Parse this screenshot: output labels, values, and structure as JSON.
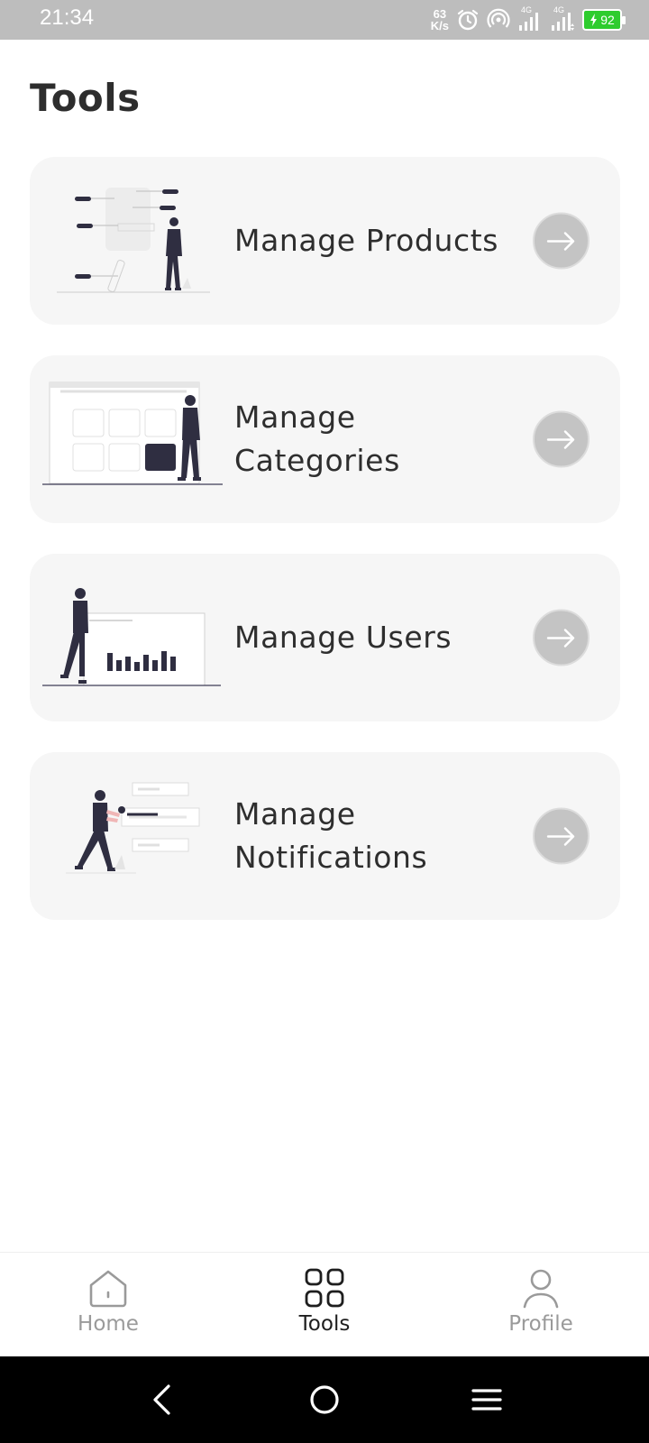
{
  "status_bar": {
    "time": "21:34",
    "net_speed_value": "63",
    "net_speed_unit": "K/s",
    "network_tag_1": "4G",
    "network_tag_2": "4G",
    "battery": "92"
  },
  "page": {
    "title": "Tools"
  },
  "tools": [
    {
      "label": "Manage Products",
      "illustration": "product-list-illustration",
      "action_icon": "arrow-right-icon"
    },
    {
      "label": "Manage Categories",
      "illustration": "category-grid-illustration",
      "action_icon": "arrow-right-icon"
    },
    {
      "label": "Manage Users",
      "illustration": "users-chart-illustration",
      "action_icon": "arrow-right-icon"
    },
    {
      "label": "Manage Notifications",
      "illustration": "notifications-illustration",
      "action_icon": "arrow-right-icon"
    }
  ],
  "bottom_nav": {
    "items": [
      {
        "label": "Home",
        "icon": "home-icon",
        "active": false
      },
      {
        "label": "Tools",
        "icon": "grid-icon",
        "active": true
      },
      {
        "label": "Profile",
        "icon": "user-icon",
        "active": false
      }
    ]
  },
  "colors": {
    "status_bar": "#bdbdbd",
    "card_bg": "#f6f6f6",
    "arrow_button": "#c4c4c4",
    "active_nav": "#1e1e1e",
    "inactive_nav": "#9a9a9a",
    "battery": "#2ecc2e"
  }
}
